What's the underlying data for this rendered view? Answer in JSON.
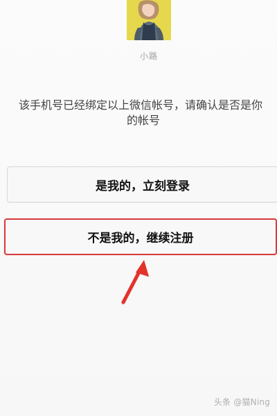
{
  "profile": {
    "nickname": "小路"
  },
  "dialog": {
    "message_line1": "该手机号已经绑定以上微信帐号，请确认是否是你",
    "message_line2": "的帐号"
  },
  "buttons": {
    "login_label": "是我的，立刻登录",
    "register_label": "不是我的，继续注册"
  },
  "watermark": {
    "text": "头条 @猫Ning"
  },
  "colors": {
    "highlight": "#d83b3b",
    "avatar_background": "#e7db4e"
  },
  "icons": {
    "arrow": "red-pointing-arrow-icon"
  }
}
